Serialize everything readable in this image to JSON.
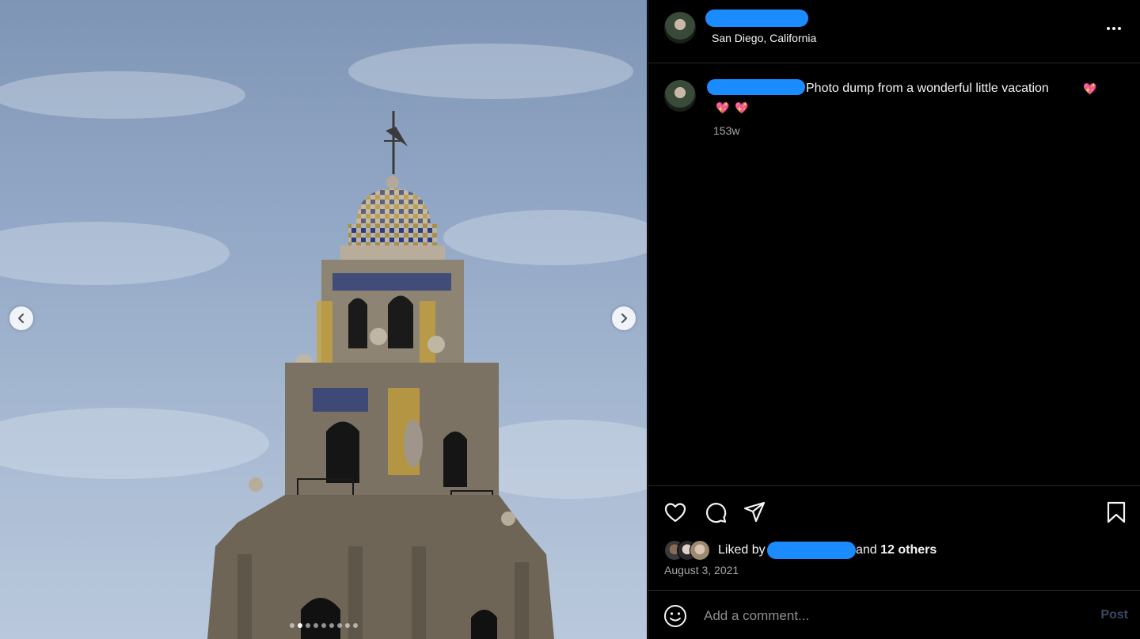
{
  "post": {
    "location": "San Diego, California",
    "caption": "Photo dump from a wonderful little vacation",
    "caption_emoji": "💖",
    "caption_emoji_2": "💖",
    "caption_emoji_3": "💖",
    "time_ago": "153w",
    "liked_by_prefix": "Liked by",
    "liked_and": "and",
    "liked_others": "12 others",
    "date": "August 3, 2021"
  },
  "carousel": {
    "total_slides": 9,
    "active_slide": 2
  },
  "comment": {
    "placeholder": "Add a comment...",
    "post_label": "Post"
  },
  "icons": [
    "more-icon",
    "like-icon",
    "comment-icon",
    "share-icon",
    "save-icon",
    "emoji-icon",
    "chevron-left-icon",
    "chevron-right-icon"
  ],
  "colors": {
    "background": "#000000",
    "redaction": "#1a8cff",
    "muted_text": "#a8a8a8",
    "post_disabled": "#3a4a63"
  }
}
